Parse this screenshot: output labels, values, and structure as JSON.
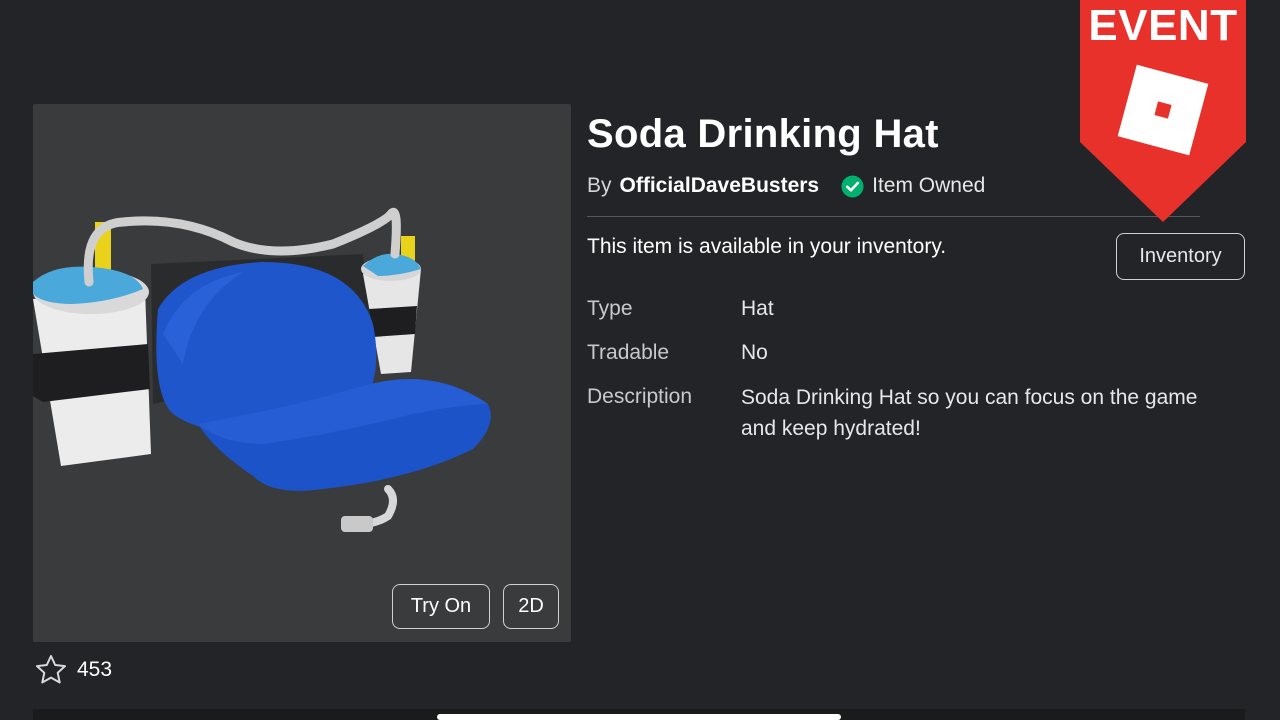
{
  "item": {
    "title": "Soda Drinking Hat",
    "by_label": "By",
    "creator": "OfficialDaveBusters",
    "owned_label": "Item Owned",
    "available_text": "This item is available in your inventory.",
    "inventory_button": "Inventory"
  },
  "preview": {
    "try_on_label": "Try On",
    "view_2d_label": "2D"
  },
  "favorites": {
    "count": "453",
    "icon": "star-outline-icon"
  },
  "details": [
    {
      "label": "Type",
      "value": "Hat"
    },
    {
      "label": "Tradable",
      "value": "No"
    },
    {
      "label": "Description",
      "value": "Soda Drinking Hat so you can focus on the game and keep hydrated!"
    }
  ],
  "event_banner": {
    "text": "EVENT",
    "icon": "roblox-logo-icon",
    "color": "#e8312a"
  },
  "colors": {
    "background": "#232427",
    "preview_background": "#393b3d",
    "owned_check": "#00b06f",
    "hat_blue": "#1b4fc4"
  }
}
